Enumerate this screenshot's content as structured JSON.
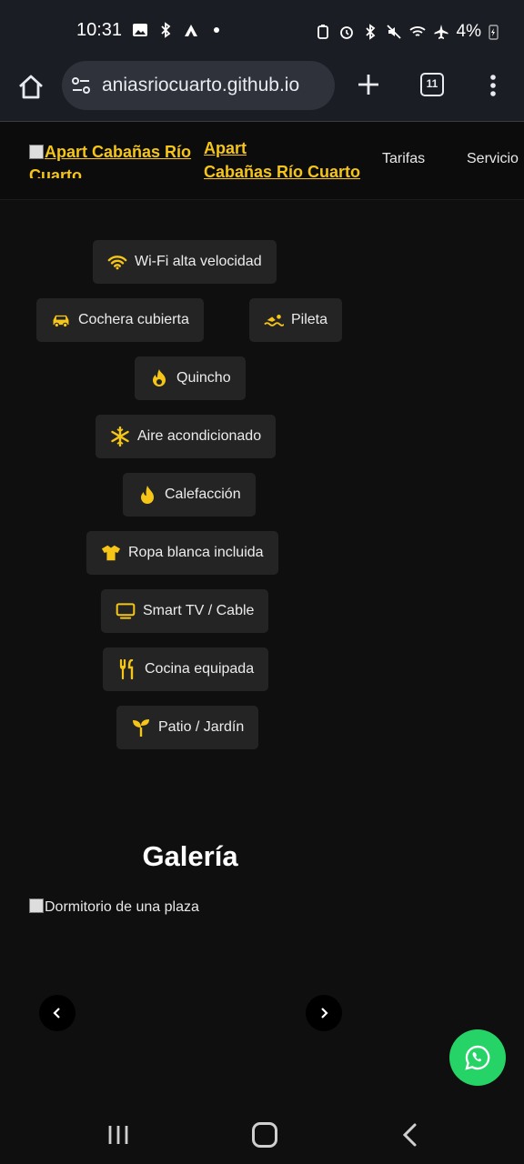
{
  "status_bar": {
    "time": "10:31",
    "battery": "4%",
    "icons_left": [
      "image-icon",
      "bluetooth-icon",
      "app-a-icon",
      "dot-icon"
    ],
    "icons_right": [
      "battery-saver-icon",
      "alarm-icon",
      "bluetooth-icon",
      "mute-icon",
      "wifi-icon",
      "airplane-icon",
      "battery-icon"
    ]
  },
  "browser": {
    "url": "aniasriocuarto.github.io",
    "tab_count": "11"
  },
  "header": {
    "logo_alt": "Apart Cabañas Río Cuarto",
    "brand_line1": "Apart",
    "brand_line2": "Cabañas Río Cuarto",
    "nav": [
      "Tarifas",
      "Servicio"
    ]
  },
  "amenities": [
    {
      "label": "Wi-Fi alta velocidad",
      "icon": "wifi-icon"
    },
    {
      "label": "Cochera cubierta",
      "icon": "car-icon"
    },
    {
      "label": "Pileta",
      "icon": "swimmer-icon"
    },
    {
      "label": "Quincho",
      "icon": "fire-icon"
    },
    {
      "label": "Aire acondicionado",
      "icon": "snowflake-icon"
    },
    {
      "label": "Calefacción",
      "icon": "flame-icon"
    },
    {
      "label": "Ropa blanca incluida",
      "icon": "shirt-icon"
    },
    {
      "label": "Smart TV / Cable",
      "icon": "tv-icon"
    },
    {
      "label": "Cocina equipada",
      "icon": "utensils-icon"
    },
    {
      "label": "Patio / Jardín",
      "icon": "seedling-icon"
    }
  ],
  "gallery": {
    "title": "Galería",
    "image_alt": "Dormitorio de una plaza"
  },
  "colors": {
    "accent": "#f5c518",
    "background": "#0f0f0f",
    "chip": "#242424",
    "whatsapp": "#25d366"
  }
}
